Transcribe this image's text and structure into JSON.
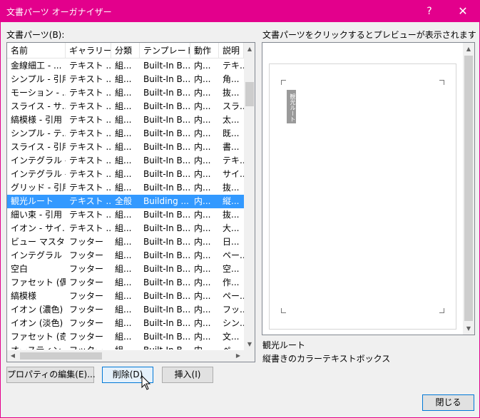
{
  "window": {
    "title": "文書パーツ オーガナイザー",
    "help_glyph": "?",
    "close_glyph": "✕",
    "accent_color": "#e3008c"
  },
  "list": {
    "label": "文書パーツ(B):",
    "columns": [
      "名前",
      "ギャラリー",
      "分類",
      "テンプレート",
      "動作",
      "説明"
    ],
    "rows": [
      [
        "金線細工 - ...",
        "テキスト ...",
        "組...",
        "Built-In B...",
        "内...",
        "テキ..."
      ],
      [
        "シンプル - 引用",
        "テキスト ...",
        "組...",
        "Built-In B...",
        "内...",
        "角..."
      ],
      [
        "モーション - ...",
        "テキスト ...",
        "組...",
        "Built-In B...",
        "内...",
        "抜..."
      ],
      [
        "スライス - サ...",
        "テキスト ...",
        "組...",
        "Built-In B...",
        "内...",
        "スラ..."
      ],
      [
        "縞模様 - 引用",
        "テキスト ...",
        "組...",
        "Built-In B...",
        "内...",
        "太..."
      ],
      [
        " シンプル - テ...",
        "テキスト ...",
        "組...",
        "Built-In B...",
        "内...",
        "既..."
      ],
      [
        "スライス - 引用",
        "テキスト ...",
        "組...",
        "Built-In B...",
        "内...",
        "書..."
      ],
      [
        "インテグラル -...",
        "テキスト ...",
        "組...",
        "Built-In B...",
        "内...",
        "テキ..."
      ],
      [
        "インテグラル -...",
        "テキスト ...",
        "組...",
        "Built-In B...",
        "内...",
        "サイ..."
      ],
      [
        "グリッド - 引用",
        "テキスト ...",
        "組...",
        "Built-In B...",
        "内...",
        "抜..."
      ],
      [
        "観光ルート",
        "テキスト ...",
        "全般",
        "Building ...",
        "内...",
        "縦..."
      ],
      [
        "細い束 - 引用",
        "テキスト ...",
        "組...",
        "Built-In B...",
        "内...",
        "抜..."
      ],
      [
        "イオン - サイ...",
        "テキスト ...",
        "組...",
        "Built-In B...",
        "内...",
        "大..."
      ],
      [
        "ビュー マスター...",
        "フッター",
        "組...",
        "Built-In B...",
        "内...",
        "日..."
      ],
      [
        "インテグラル",
        "フッター",
        "組...",
        "Built-In B...",
        "内...",
        "ペー..."
      ],
      [
        " 空白",
        "フッター",
        "組...",
        "Built-In B...",
        "内...",
        "空..."
      ],
      [
        "ファセット (偶...",
        "フッター",
        "組...",
        "Built-In B...",
        "内...",
        "作..."
      ],
      [
        "縞模様",
        "フッター",
        "組...",
        "Built-In B...",
        "内...",
        "ペー..."
      ],
      [
        "イオン (濃色)",
        "フッター",
        "組...",
        "Built-In B...",
        "内...",
        "フッ..."
      ],
      [
        "イオン (淡色)",
        "フッター",
        "組...",
        "Built-In B...",
        "内...",
        "シン..."
      ],
      [
        "ファセット (奇...",
        "フッター",
        "組...",
        "Built-In B...",
        "内...",
        "文..."
      ],
      [
        "オースティン",
        "フッター",
        "組...",
        "Built-In B...",
        "内...",
        "ペ..."
      ]
    ],
    "selected_index": 10
  },
  "preview": {
    "label": "文書パーツをクリックするとプレビューが表示されます",
    "textbox_text": "観光ルート",
    "selected_name": "観光ルート",
    "selected_description": "縦書きのカラーテキストボックス"
  },
  "buttons": {
    "properties": "プロパティの編集(E)...",
    "delete": "削除(D)",
    "insert": "挿入(I)",
    "close": "閉じる"
  }
}
